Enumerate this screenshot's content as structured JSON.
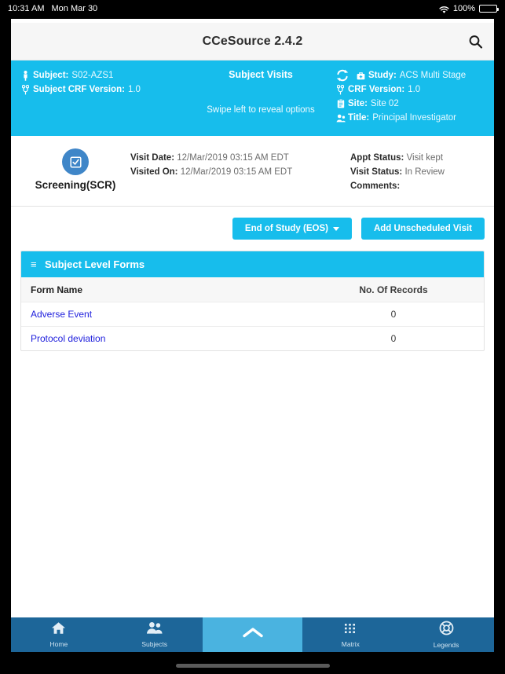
{
  "status_bar": {
    "time": "10:31 AM",
    "date": "Mon Mar 30",
    "wifi_icon": "wifi-icon",
    "battery_percent": "100%",
    "battery_icon": "battery-icon"
  },
  "navbar": {
    "title": "CCeSource 2.4.2",
    "search_icon": "search-icon"
  },
  "info_header": {
    "left": [
      {
        "icon": "person-icon",
        "label": "Subject:",
        "value": "S02-AZS1"
      },
      {
        "icon": "version-branch-icon",
        "label": "Subject CRF Version:",
        "value": "1.0"
      }
    ],
    "center_title": "Subject Visits",
    "swipe_hint": "Swipe left to reveal options",
    "refresh_icon": "refresh-icon",
    "right": [
      {
        "icon": "briefcase-medical-icon",
        "label": "Study:",
        "value": "ACS Multi Stage"
      },
      {
        "icon": "version-branch-icon",
        "label": "CRF Version:",
        "value": "1.0"
      },
      {
        "icon": "clipboard-icon",
        "label": "Site:",
        "value": "Site 02"
      },
      {
        "icon": "user-tie-icon",
        "label": "Title:",
        "value": "Principal Investigator"
      }
    ],
    "background_color": "#17bdec"
  },
  "visit": {
    "icon": "checked-box-icon",
    "circle_color": "#3f86c8",
    "name": "Screening(SCR)",
    "details_left": [
      {
        "label": "Visit Date:",
        "value": "12/Mar/2019 03:15 AM EDT"
      },
      {
        "label": "Visited On:",
        "value": "12/Mar/2019 03:15 AM EDT"
      }
    ],
    "details_right": [
      {
        "label": "Appt Status:",
        "value": "Visit kept"
      },
      {
        "label": "Visit Status:",
        "value": "In Review"
      },
      {
        "label": "Comments:",
        "value": ""
      }
    ]
  },
  "actions": {
    "eos_button": "End of Study (EOS)",
    "eos_caret_icon": "caret-down-icon",
    "add_visit_button": "Add Unscheduled Visit"
  },
  "forms_table": {
    "panel_icon": "hamburger-icon",
    "panel_title": "Subject Level Forms",
    "columns": [
      "Form Name",
      "No. Of Records"
    ],
    "rows": [
      {
        "name": "Adverse Event",
        "records": "0"
      },
      {
        "name": "Protocol deviation",
        "records": "0"
      }
    ]
  },
  "tabbar": {
    "items": [
      {
        "icon": "home-icon",
        "label": "Home"
      },
      {
        "icon": "subjects-people-icon",
        "label": "Subjects"
      },
      {
        "icon": "chevron-up-icon",
        "label": ""
      },
      {
        "icon": "matrix-grid-icon",
        "label": "Matrix"
      },
      {
        "icon": "legends-lifebuoy-icon",
        "label": "Legends"
      }
    ],
    "active_index": 2,
    "background_color": "#1d6699",
    "active_color": "#4ab3e0"
  }
}
